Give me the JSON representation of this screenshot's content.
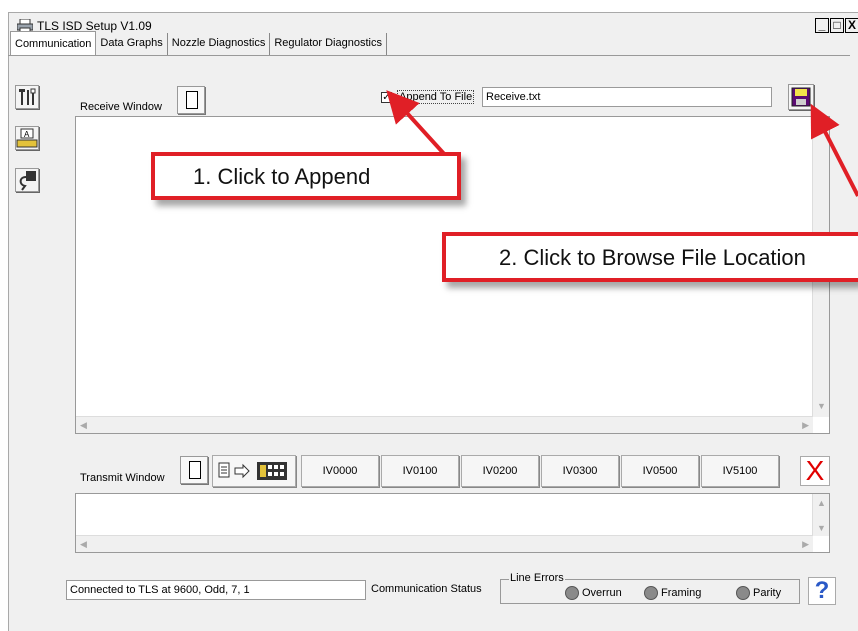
{
  "window": {
    "title": "TLS ISD Setup V1.09",
    "controls": {
      "minimize": "_",
      "maximize": "□",
      "close": "X"
    }
  },
  "tabs": [
    {
      "label": "Communication",
      "active": true
    },
    {
      "label": "Data Graphs",
      "active": false
    },
    {
      "label": "Nozzle Diagnostics",
      "active": false
    },
    {
      "label": "Regulator Diagnostics",
      "active": false
    }
  ],
  "sidebar": {
    "icons": [
      "tools-icon",
      "keyboard-icon",
      "cable-connector-icon"
    ]
  },
  "receive": {
    "label": "Receive Window",
    "append_checked": true,
    "append_label": "Append To File",
    "file_name": "Receive.txt"
  },
  "transmit": {
    "label": "Transmit Window",
    "commands": [
      "IV0000",
      "IV0100",
      "IV0200",
      "IV0300",
      "IV0500",
      "IV5100"
    ],
    "clear_symbol": "X"
  },
  "status": {
    "connection": "Connected to TLS at 9600, Odd, 7, 1",
    "label": "Communication Status",
    "line_errors_title": "Line Errors",
    "errors": [
      "Overrun",
      "Framing",
      "Parity"
    ],
    "help_symbol": "?"
  },
  "callouts": {
    "append": "1.  Click to Append",
    "browse": "2.  Click to Browse File Location"
  },
  "colors": {
    "callout_red": "#e01f26",
    "led_gray": "#8a8a8a",
    "save_purple": "#5b0a73",
    "help_blue": "#2a59c7"
  }
}
